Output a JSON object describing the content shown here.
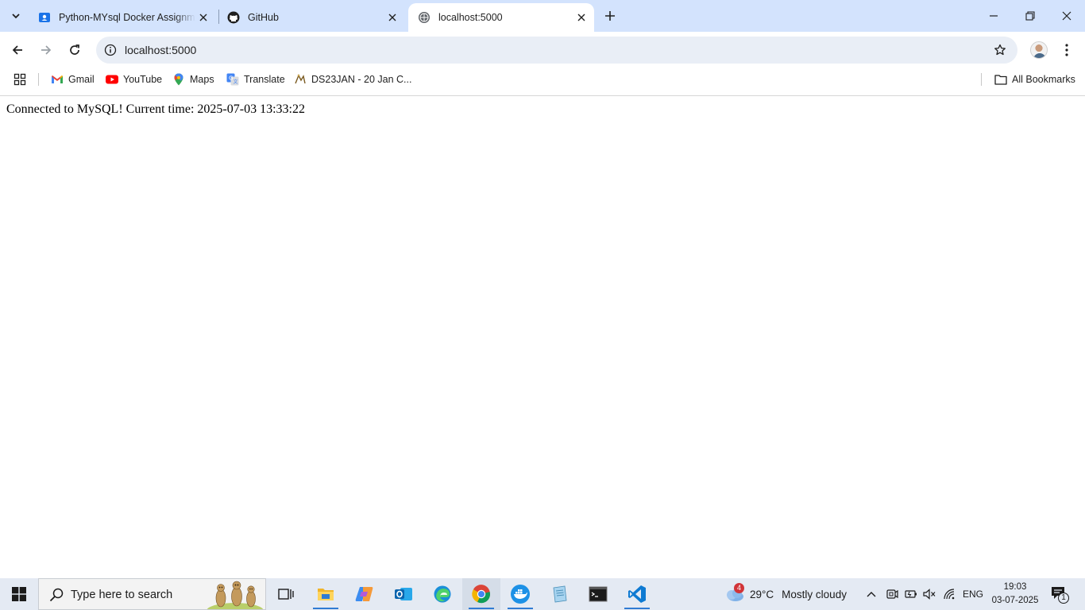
{
  "browser": {
    "tabs": [
      {
        "title": "Python-MYsql Docker Assignme",
        "favicon": "classroom-icon",
        "active": false
      },
      {
        "title": "GitHub",
        "favicon": "github-icon",
        "active": false
      },
      {
        "title": "localhost:5000",
        "favicon": "globe-icon",
        "active": true
      }
    ],
    "address_bar": {
      "url": "localhost:5000"
    },
    "bookmarks": [
      {
        "label": "Gmail",
        "icon": "gmail-icon"
      },
      {
        "label": "YouTube",
        "icon": "youtube-icon"
      },
      {
        "label": "Maps",
        "icon": "maps-icon"
      },
      {
        "label": "Translate",
        "icon": "translate-icon"
      },
      {
        "label": "DS23JAN - 20 Jan C...",
        "icon": "bookmark-site-icon"
      }
    ],
    "all_bookmarks_label": "All Bookmarks",
    "accent_color": "#d3e3fd"
  },
  "page": {
    "text": "Connected to MySQL! Current time: 2025-07-03 13:33:22"
  },
  "taskbar": {
    "search_placeholder": "Type here to search",
    "weather": {
      "badge": "4",
      "temperature": "29°C",
      "condition": "Mostly cloudy"
    },
    "language": "ENG",
    "time": "19:03",
    "date": "03-07-2025",
    "notification_count": "1",
    "apps": [
      "task-view-icon",
      "file-explorer-icon",
      "copilot-icon",
      "outlook-icon",
      "edge-icon",
      "chrome-icon",
      "docker-icon",
      "notepad-icon",
      "terminal-icon",
      "vscode-icon"
    ]
  }
}
